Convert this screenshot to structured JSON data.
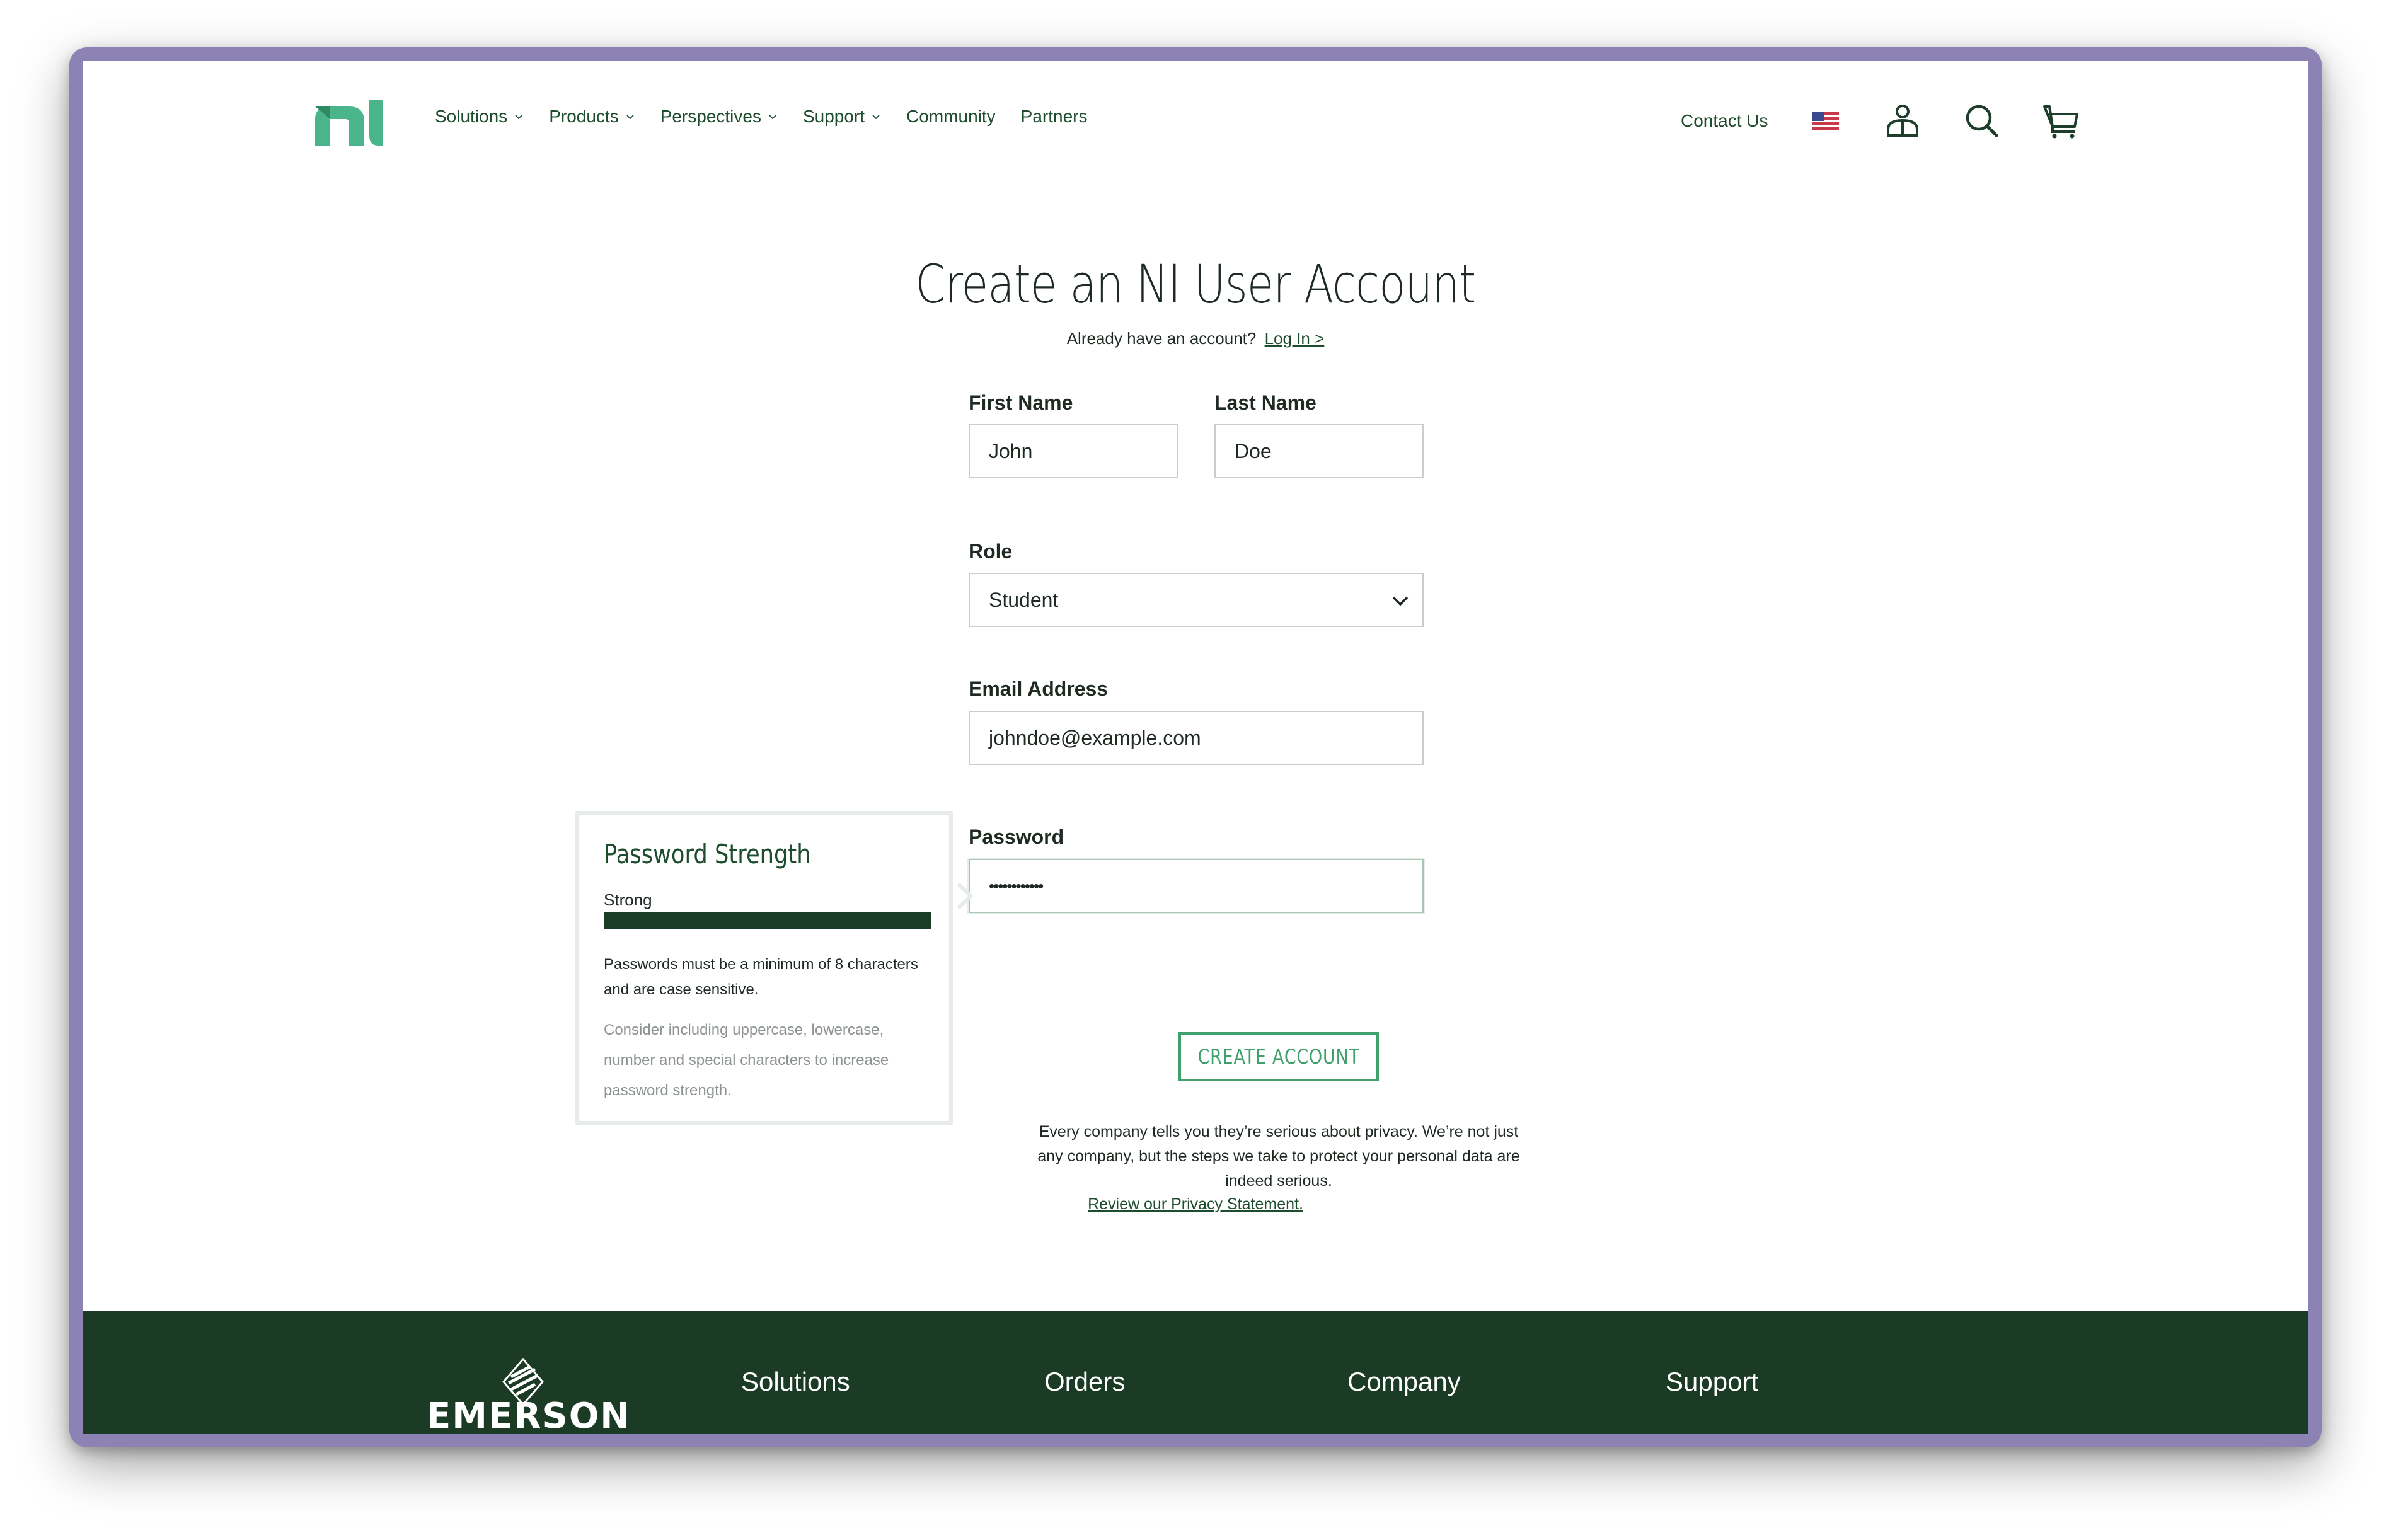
{
  "header": {
    "nav": [
      {
        "label": "Solutions",
        "dropdown": true
      },
      {
        "label": "Products",
        "dropdown": true
      },
      {
        "label": "Perspectives",
        "dropdown": true
      },
      {
        "label": "Support",
        "dropdown": true
      },
      {
        "label": "Community",
        "dropdown": false
      },
      {
        "label": "Partners",
        "dropdown": false
      }
    ],
    "contact_label": "Contact Us",
    "icons": [
      "us-flag-icon",
      "user-account-icon",
      "search-icon",
      "cart-icon"
    ]
  },
  "main": {
    "title": "Create an NI User Account",
    "already_text": "Already have an account?",
    "login_link": "Log In >",
    "first_name": {
      "label": "First Name",
      "value": "John"
    },
    "last_name": {
      "label": "Last Name",
      "value": "Doe"
    },
    "role": {
      "label": "Role",
      "value": "Student"
    },
    "email": {
      "label": "Email Address",
      "value": "johndoe@example.com"
    },
    "password": {
      "label": "Password",
      "value": "••••••••••••"
    },
    "create_button": "CREATE ACCOUNT",
    "privacy_text": "Every company tells you they’re serious about privacy. We’re not just any company, but the steps we take to protect your personal data are indeed serious.",
    "privacy_link": "Review our Privacy Statement."
  },
  "password_strength": {
    "title": "Password Strength",
    "level": "Strong",
    "fill_fraction": 1.0,
    "rule_text": "Passwords must be a minimum of 8 characters and are case sensitive.",
    "hint_text": "Consider including uppercase, lowercase, number and special characters to increase password strength."
  },
  "footer": {
    "brand": "EMERSON",
    "columns": [
      "Solutions",
      "Orders",
      "Company",
      "Support"
    ]
  },
  "colors": {
    "brand_green": "#1e4d2e",
    "accent_green": "#3fa06b",
    "footer_bg": "#1b3b25",
    "frame": "#8c82b3"
  }
}
